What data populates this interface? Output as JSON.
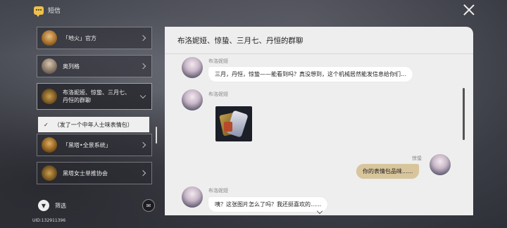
{
  "app": {
    "title": "短信",
    "uid": "UID:132911396"
  },
  "sidebar": {
    "items": [
      {
        "label": "「地火」官方",
        "avatar": "fire-emblem"
      },
      {
        "label": "奥列格",
        "avatar": "old-man"
      },
      {
        "label_line1": "布洛妮娅、惊蛰、三月七、",
        "label_line2": "丹恒的群聊",
        "avatar": "group"
      },
      {
        "label": "「黑塔•全景系统」",
        "avatar": "tower-emblem"
      },
      {
        "label": "黑塔女士单推协会",
        "avatar": "group"
      }
    ],
    "sub_option": {
      "check": "✓",
      "text": "（发了一个中年人士味表情包）"
    },
    "filter_label": "筛选"
  },
  "chat": {
    "title": "布洛妮娅、惊蛰、三月七、丹恒的群聊",
    "messages": [
      {
        "sender": "布洛妮娅",
        "text": "三月，丹恒，惊蛰——能看到吗？真没想到，这个机械居然能发信息给你们..."
      },
      {
        "sender": "布洛妮娅",
        "sticker": "sticker-image"
      },
      {
        "sender": "惊蛰",
        "text": "你的表情包品味......"
      },
      {
        "sender": "布洛妮娅",
        "text": "咦？这张图片怎么了吗？我还挺喜欢的......"
      }
    ]
  },
  "colors": {
    "my_bubble": "#d8c59c",
    "panel_bg": "#eeeeee",
    "accent": "#f0c04a"
  }
}
